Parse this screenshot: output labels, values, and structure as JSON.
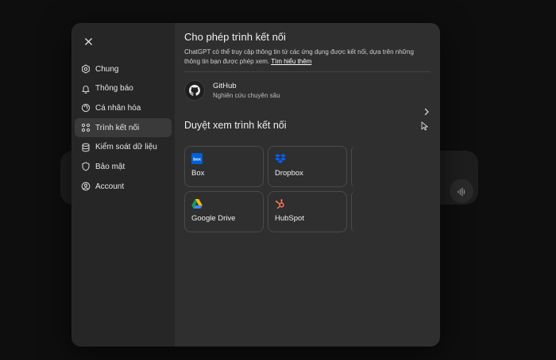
{
  "colors": {
    "modal_bg": "#2f2f2f",
    "sidebar_bg": "#262626",
    "active_bg": "#3a3a3a"
  },
  "sidebar": {
    "items": [
      {
        "label": "Chung",
        "icon": "gear-icon"
      },
      {
        "label": "Thông báo",
        "icon": "bell-icon"
      },
      {
        "label": "Cá nhân hóa",
        "icon": "personalize-icon"
      },
      {
        "label": "Trình kết nối",
        "icon": "connectors-icon",
        "active": true
      },
      {
        "label": "Kiểm soát dữ liệu",
        "icon": "database-icon"
      },
      {
        "label": "Bảo mật",
        "icon": "shield-icon"
      },
      {
        "label": "Account",
        "icon": "user-icon"
      }
    ]
  },
  "content": {
    "title": "Cho phép trình kết nối",
    "description": "ChatGPT có thể truy cập thông tin từ các ứng dụng được kết nối, dựa trên những thông tin bạn được phép xem.",
    "learn_more": "Tìm hiểu thêm",
    "connected": {
      "name": "GitHub",
      "subtitle": "Nghiên cứu chuyên sâu"
    },
    "browse_title": "Duyệt xem trình kết nối",
    "connectors": [
      {
        "name": "Box",
        "icon": "box-logo-icon"
      },
      {
        "name": "Dropbox",
        "icon": "dropbox-logo-icon"
      },
      {
        "name": "Google Drive",
        "icon": "google-drive-logo-icon"
      },
      {
        "name": "HubSpot",
        "icon": "hubspot-logo-icon"
      }
    ]
  }
}
